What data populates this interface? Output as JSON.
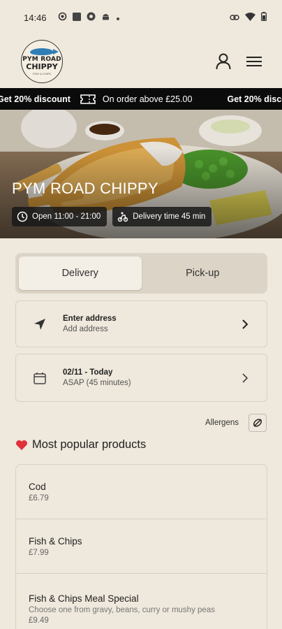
{
  "status_bar": {
    "time": "14:46"
  },
  "header": {
    "logo_line1": "PYM ROAD",
    "logo_line2": "CHIPPY",
    "logo_tagline": "FISH & CHIPS"
  },
  "ticker": {
    "left_text": "Get 20% discount",
    "middle_text": "On order above £25.00",
    "right_text": "Get 20% discount"
  },
  "hero": {
    "title": "PYM ROAD CHIPPY",
    "opening_hours": "Open 11:00 - 21:00",
    "delivery_time": "Delivery time 45 min"
  },
  "order_mode": {
    "delivery_label": "Delivery",
    "pickup_label": "Pick-up",
    "selected": "Delivery"
  },
  "address_card": {
    "title": "Enter address",
    "subtitle": "Add address"
  },
  "time_card": {
    "title": "02/11 - Today",
    "subtitle": "ASAP (45 minutes)"
  },
  "allergens": {
    "label": "Allergens"
  },
  "popular": {
    "title": "Most popular products",
    "products": [
      {
        "name": "Cod",
        "description": "",
        "price": "£6.79"
      },
      {
        "name": "Fish  & Chips",
        "description": "",
        "price": "£7.99"
      },
      {
        "name": "Fish & Chips Meal Special",
        "description": "Choose one from gravy, beans, curry or mushy peas",
        "price": "£9.49"
      }
    ]
  },
  "colors": {
    "background": "#efe8dc",
    "ticker_bg": "#0b0b0b",
    "accent_heart": "#e0303a"
  }
}
